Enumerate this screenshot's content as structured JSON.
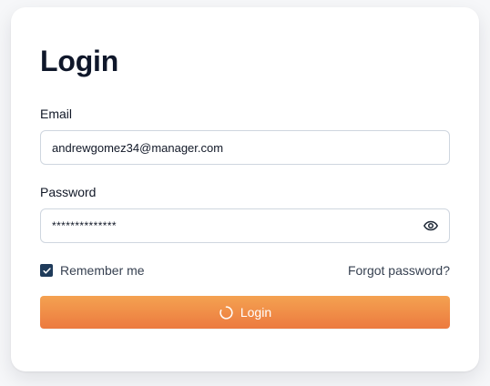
{
  "login": {
    "title": "Login",
    "email_label": "Email",
    "email_value": "andrewgomez34@manager.com",
    "password_label": "Password",
    "password_value": "**************",
    "remember_label": "Remember me",
    "forgot_label": "Forgot password?",
    "button_label": "Login"
  },
  "icons": {
    "eye": "eye-icon",
    "checkbox": "checkmark-icon",
    "spinner": "loading-spinner-icon"
  },
  "colors": {
    "button_top": "#f4a251",
    "button_bottom": "#ec7a3f",
    "checkbox": "#1f3b5a",
    "title": "#0f172a",
    "border": "#cfd6df"
  }
}
